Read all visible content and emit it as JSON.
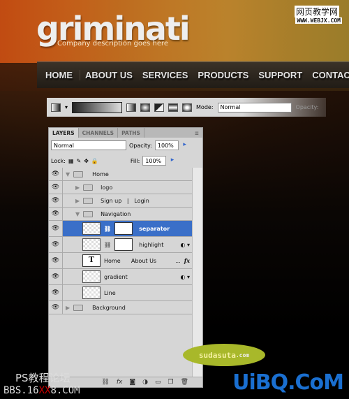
{
  "site": {
    "logo": "griminati",
    "tagline": "Company description goes here",
    "nav": [
      "HOME",
      "ABOUT US",
      "SERVICES",
      "PRODUCTS",
      "SUPPORT",
      "CONTAC"
    ]
  },
  "toolbar": {
    "mode_label": "Mode:",
    "mode_value": "Normal",
    "opacity_label": "Opacity:"
  },
  "panel": {
    "tabs": [
      "LAYERS",
      "CHANNELS",
      "PATHS"
    ],
    "blend_mode": "Normal",
    "opacity_label": "Opacity:",
    "opacity": "100%",
    "lock_label": "Lock:",
    "fill_label": "Fill:",
    "fill": "100%",
    "layers": [
      {
        "name": "Home",
        "type": "group",
        "expanded": true,
        "indent": 0
      },
      {
        "name": "logo",
        "type": "group",
        "expanded": false,
        "indent": 1
      },
      {
        "name": "Sign up   |   Login",
        "type": "group",
        "expanded": false,
        "indent": 1
      },
      {
        "name": "Navigation",
        "type": "group",
        "expanded": true,
        "indent": 1
      },
      {
        "name": "separator",
        "type": "smart-masked",
        "selected": true
      },
      {
        "name": "highlight",
        "type": "smart-masked"
      },
      {
        "name": "Home      About Us",
        "suffix": "...",
        "type": "text",
        "fx": "fx"
      },
      {
        "name": "gradient",
        "type": "smart"
      },
      {
        "name": "Line",
        "type": "layer"
      },
      {
        "name": "Background",
        "type": "group",
        "expanded": false,
        "indent": 0
      }
    ]
  },
  "watermarks": {
    "top_cn": "网页教学网",
    "top_url": "WWW.WEBJX.COM",
    "bubble": "sudasuta",
    "bubble_tld": ".com",
    "left_cn": "PS教程论坛",
    "left_url_a": "BBS.16",
    "left_url_b": "XX",
    "left_url_c": "8.COM",
    "right": "UiBQ.CoM"
  },
  "colors": {
    "selection": "#3a6fc8",
    "bubble": "#a8b82a",
    "uibq": "#1a6fd0"
  }
}
